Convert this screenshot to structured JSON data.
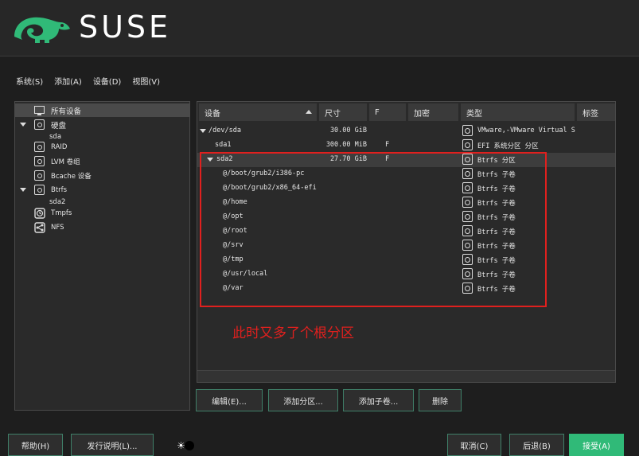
{
  "brand": {
    "name": "SUSE"
  },
  "menu": [
    "系统(S)",
    "添加(A)",
    "设备(D)",
    "视图(V)"
  ],
  "tree": [
    {
      "label": "所有设备",
      "icon": "monitor-icon",
      "expand": false
    },
    {
      "label": "硬盘",
      "icon": "disk-icon",
      "expand": true
    },
    {
      "label": "sda",
      "icon": "",
      "expand": false
    },
    {
      "label": "RAID",
      "icon": "disk-icon",
      "expand": false
    },
    {
      "label": "LVM 卷组",
      "icon": "disk-icon",
      "expand": false
    },
    {
      "label": "Bcache 设备",
      "icon": "disk-icon",
      "expand": false
    },
    {
      "label": "Btrfs",
      "icon": "disk-icon",
      "expand": true
    },
    {
      "label": "sda2",
      "icon": "",
      "expand": false
    },
    {
      "label": "Tmpfs",
      "icon": "tmpfs-icon",
      "expand": false
    },
    {
      "label": "NFS",
      "icon": "nfs-icon",
      "expand": false
    }
  ],
  "table": {
    "columns": [
      "设备",
      "尺寸",
      "F",
      "加密",
      "类型",
      "标签"
    ],
    "rows": [
      {
        "device": "/dev/sda",
        "size": "30.00 GiB",
        "f": "",
        "type": "VMware,-VMware Virtual S"
      },
      {
        "device": "sda1",
        "size": "300.00 MiB",
        "f": "F",
        "type": "EFI 系统分区 分区"
      },
      {
        "device": "sda2",
        "size": "27.70 GiB",
        "f": "F",
        "type": "Btrfs 分区"
      },
      {
        "device": "@/boot/grub2/i386-pc",
        "size": "",
        "f": "",
        "type": "Btrfs 子卷"
      },
      {
        "device": "@/boot/grub2/x86_64-efi",
        "size": "",
        "f": "",
        "type": "Btrfs 子卷"
      },
      {
        "device": "@/home",
        "size": "",
        "f": "",
        "type": "Btrfs 子卷"
      },
      {
        "device": "@/opt",
        "size": "",
        "f": "",
        "type": "Btrfs 子卷"
      },
      {
        "device": "@/root",
        "size": "",
        "f": "",
        "type": "Btrfs 子卷"
      },
      {
        "device": "@/srv",
        "size": "",
        "f": "",
        "type": "Btrfs 子卷"
      },
      {
        "device": "@/tmp",
        "size": "",
        "f": "",
        "type": "Btrfs 子卷"
      },
      {
        "device": "@/usr/local",
        "size": "",
        "f": "",
        "type": "Btrfs 子卷"
      },
      {
        "device": "@/var",
        "size": "",
        "f": "",
        "type": "Btrfs 子卷"
      }
    ]
  },
  "annotation": "此时又多了个根分区",
  "actions": {
    "edit": "编辑(E)...",
    "add_partition": "添加分区...",
    "add_subvolume": "添加子卷...",
    "delete": "删除"
  },
  "footer": {
    "help": "帮助(H)",
    "release_notes": "发行说明(L)...",
    "cancel": "取消(C)",
    "back": "后退(B)",
    "accept": "接受(A)"
  },
  "colors": {
    "accent": "#30ba78",
    "annotation": "#e0201e"
  }
}
